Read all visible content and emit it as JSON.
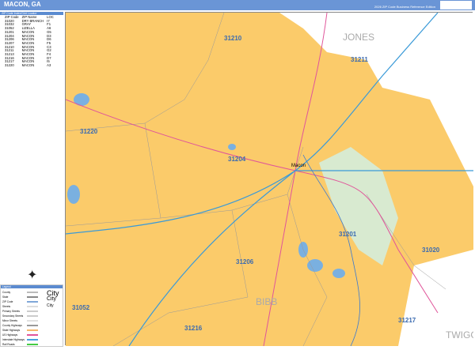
{
  "header": {
    "title": "MACON, GA",
    "edition": "2026 ZIP Code Business Reference Edition",
    "logo": "Market MAPS"
  },
  "index": {
    "title": "ZIP Code Index/Grid Locator",
    "columns": [
      "ZIP Code",
      "ZIP Name",
      "LOC"
    ],
    "rows": [
      [
        "31020",
        "DRY BRANCH",
        "I7"
      ],
      [
        "31032",
        "GRAY",
        "F1"
      ],
      [
        "31052",
        "LIZELLA",
        "A6"
      ],
      [
        "31201",
        "MACON",
        "G5"
      ],
      [
        "31204",
        "MACON",
        "D3"
      ],
      [
        "31206",
        "MACON",
        "D6"
      ],
      [
        "31207",
        "MACON",
        "F5"
      ],
      [
        "31210",
        "MACON",
        "C3"
      ],
      [
        "31211",
        "MACON",
        "G2"
      ],
      [
        "31213",
        "MACON",
        "F4"
      ],
      [
        "31216",
        "MACON",
        "D7"
      ],
      [
        "31217",
        "MACON",
        "I5"
      ],
      [
        "31220",
        "MACON",
        "A3"
      ]
    ]
  },
  "legend": {
    "title": "Legend",
    "items": [
      {
        "label": "County",
        "color": "#bbbbbb"
      },
      {
        "label": "State",
        "color": "#888888"
      },
      {
        "label": "ZIP Code",
        "color": "#7fa7d8"
      },
      {
        "label": "Streets",
        "color": "#dddddd"
      },
      {
        "label": "Primary Streets",
        "color": "#cccccc"
      },
      {
        "label": "Secondary Streets",
        "color": "#cccccc"
      },
      {
        "label": "Minor Streets",
        "color": "#e0e0e0"
      },
      {
        "label": "County Highways",
        "color": "#999999"
      },
      {
        "label": "State Highways",
        "color": "#f6b66a"
      },
      {
        "label": "US Highways",
        "color": "#e0559a"
      },
      {
        "label": "Interstate Highways",
        "color": "#4aa0e0"
      },
      {
        "label": "Rail Roads",
        "color": "#44cc44"
      }
    ],
    "cities": [
      {
        "label": "City",
        "size": "large"
      },
      {
        "label": "City",
        "size": "medium"
      },
      {
        "label": "City",
        "size": "small"
      }
    ]
  },
  "map": {
    "colors": {
      "zip": "#fbcb6a",
      "outside": "#ffffff",
      "water": "#7ab0e0",
      "park": "#d8ead0",
      "interstate": "#3a9ad8",
      "us_highway": "#e0559a"
    },
    "labels": [
      {
        "text": "31210",
        "kind": "zip"
      },
      {
        "text": "JONES",
        "kind": "county"
      },
      {
        "text": "31211",
        "kind": "zip"
      },
      {
        "text": "31220",
        "kind": "zip"
      },
      {
        "text": "31204",
        "kind": "zip"
      },
      {
        "text": "Macon",
        "kind": "city"
      },
      {
        "text": "31201",
        "kind": "zip"
      },
      {
        "text": "31206",
        "kind": "zip"
      },
      {
        "text": "BIBB",
        "kind": "county"
      },
      {
        "text": "31052",
        "kind": "zip"
      },
      {
        "text": "31216",
        "kind": "zip"
      },
      {
        "text": "31217",
        "kind": "zip"
      },
      {
        "text": "TWIGGS",
        "kind": "county"
      },
      {
        "text": "31020",
        "kind": "zip"
      }
    ]
  }
}
